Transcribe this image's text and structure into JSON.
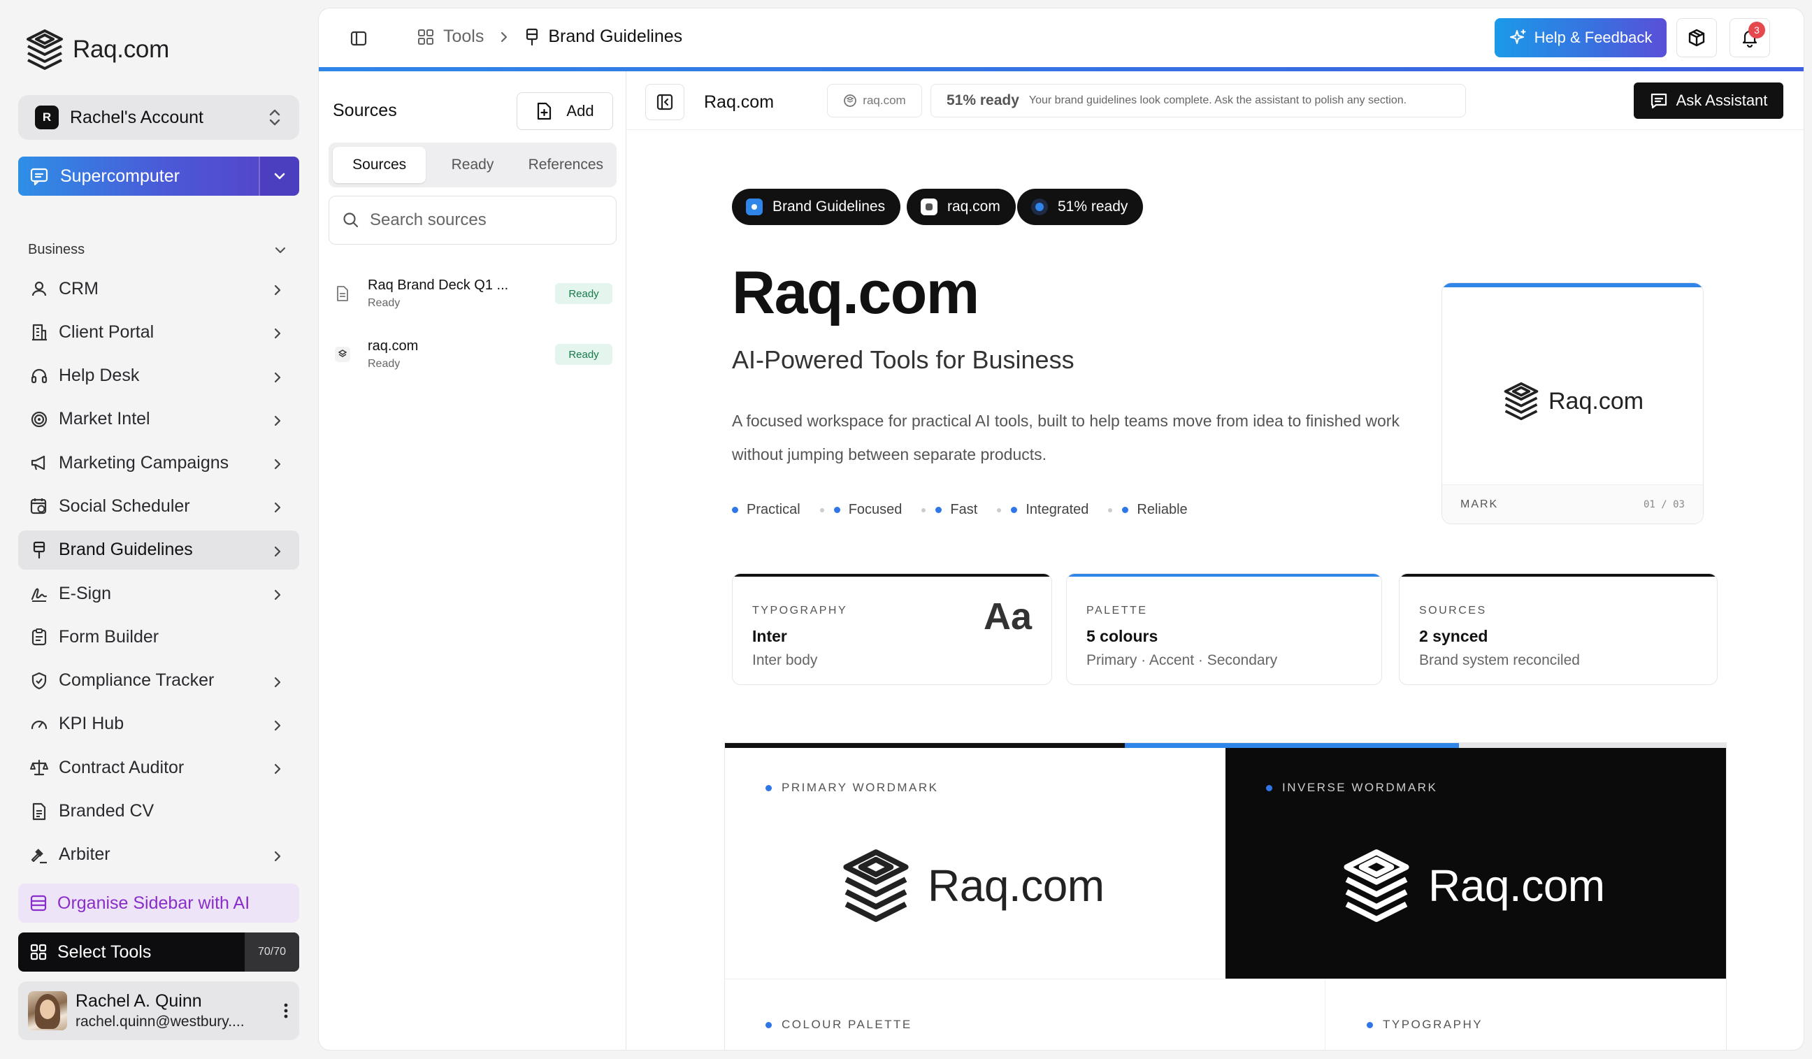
{
  "app": {
    "name": "Raq.com"
  },
  "account": {
    "initial": "R",
    "name": "Rachel's Account"
  },
  "supercomputer": {
    "label": "Supercomputer"
  },
  "section": {
    "label": "Business"
  },
  "nav": [
    {
      "label": "CRM",
      "icon": "contact-icon",
      "chevron": true
    },
    {
      "label": "Client Portal",
      "icon": "building-icon",
      "chevron": true
    },
    {
      "label": "Help Desk",
      "icon": "headset-icon",
      "chevron": true
    },
    {
      "label": "Market Intel",
      "icon": "target-icon",
      "chevron": true
    },
    {
      "label": "Marketing Campaigns",
      "icon": "megaphone-icon",
      "chevron": true
    },
    {
      "label": "Social Scheduler",
      "icon": "calendar-clock-icon",
      "chevron": true
    },
    {
      "label": "Brand Guidelines",
      "icon": "paint-bucket-icon",
      "chevron": true,
      "active": true
    },
    {
      "label": "E-Sign",
      "icon": "signature-icon",
      "chevron": true
    },
    {
      "label": "Form Builder",
      "icon": "clipboard-icon",
      "chevron": false
    },
    {
      "label": "Compliance Tracker",
      "icon": "shield-check-icon",
      "chevron": true
    },
    {
      "label": "KPI Hub",
      "icon": "gauge-icon",
      "chevron": true
    },
    {
      "label": "Contract Auditor",
      "icon": "scale-icon",
      "chevron": true
    },
    {
      "label": "Branded CV",
      "icon": "document-icon",
      "chevron": false
    },
    {
      "label": "Arbiter",
      "icon": "gavel-icon",
      "chevron": true
    }
  ],
  "organise": {
    "label": "Organise Sidebar with AI"
  },
  "select_tools": {
    "label": "Select Tools",
    "count": "70/70"
  },
  "user": {
    "name": "Rachel A. Quinn",
    "email": "rachel.quinn@westbury...."
  },
  "topbar": {
    "crumb_tools": "Tools",
    "crumb_current": "Brand Guidelines",
    "help_label": "Help & Feedback",
    "notif_count": "3"
  },
  "sources": {
    "title": "Sources",
    "add_label": "Add",
    "tabs": [
      "Sources",
      "Ready",
      "References"
    ],
    "search_placeholder": "Search sources",
    "items": [
      {
        "name": "Raq Brand Deck Q1 ...",
        "status": "Ready",
        "badge": "Ready",
        "icon": "file-icon"
      },
      {
        "name": "raq.com",
        "status": "Ready",
        "badge": "Ready",
        "icon": "favicon-icon"
      }
    ]
  },
  "content": {
    "title": "Raq.com",
    "domain": "raq.com",
    "ready_pct": "51% ready",
    "ready_msg": "Your brand guidelines look complete. Ask the assistant to polish any section.",
    "ask_label": "Ask Assistant"
  },
  "pills": [
    "Brand Guidelines",
    "raq.com",
    "51% ready"
  ],
  "brand": {
    "name": "Raq.com",
    "tagline": "AI-Powered Tools for Business",
    "description": "A focused workspace for practical AI tools, built to help teams move from idea to finished work without jumping between separate products.",
    "values": [
      "Practical",
      "Focused",
      "Fast",
      "Integrated",
      "Reliable"
    ]
  },
  "mark_card": {
    "logo_text": "Raq.com",
    "label": "MARK",
    "pager": "01 / 03"
  },
  "stats": [
    {
      "key": "TYPOGRAPHY",
      "value": "Inter",
      "sub": "Inter body",
      "glyph": "Aa",
      "accent": "#111111"
    },
    {
      "key": "PALETTE",
      "value": "5 colours",
      "sub": "Primary · Accent · Secondary",
      "accent": "#2f86e8"
    },
    {
      "key": "SOURCES",
      "value": "2 synced",
      "sub": "Brand system reconciled",
      "accent": "#111111"
    }
  ],
  "wordmarks": {
    "primary_label": "PRIMARY WORDMARK",
    "inverse_label": "INVERSE WORDMARK",
    "logo_text": "Raq.com",
    "palette_label": "COLOUR PALETTE",
    "typography_label": "TYPOGRAPHY"
  },
  "colors": {
    "accent": "#2f86e8",
    "dark": "#111111",
    "ready_bg": "#e3f5ec",
    "ready_text": "#197a4a",
    "organise": "#8a2ec9"
  }
}
